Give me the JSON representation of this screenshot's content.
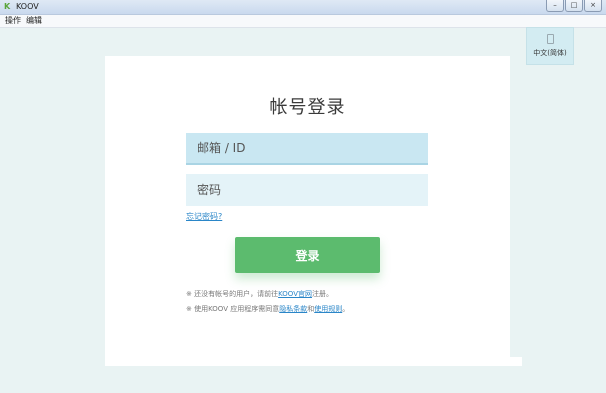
{
  "window": {
    "title": "KOOV",
    "logo_glyph": "K",
    "controls": {
      "minimize": "–",
      "maximize": "□",
      "close": "×"
    }
  },
  "menu": {
    "items": [
      {
        "label": "操作"
      },
      {
        "label": "编辑"
      }
    ]
  },
  "language": {
    "label": "中文(简体)",
    "icon": "document-icon"
  },
  "login": {
    "title": "帐号登录",
    "email_placeholder": "邮箱 / ID",
    "password_placeholder": "密码",
    "forgot_label": "忘记密码?",
    "submit_label": "登录"
  },
  "notes": {
    "line1": {
      "prefix": "※ 还没有帐号的用户，请前往",
      "link": "KOOV官网",
      "suffix": "注册。"
    },
    "line2": {
      "prefix": "※ 使用KOOV 应用程序需同意",
      "link1": "隐私条款",
      "mid": "和",
      "link2": "使用规则",
      "suffix": "。"
    }
  },
  "colors": {
    "background": "#e9f3f3",
    "card": "#ffffff",
    "email_field": "#c9e7f2",
    "password_field": "#e4f3f8",
    "login_button": "#5cbb6e",
    "link": "#2a86c8"
  }
}
